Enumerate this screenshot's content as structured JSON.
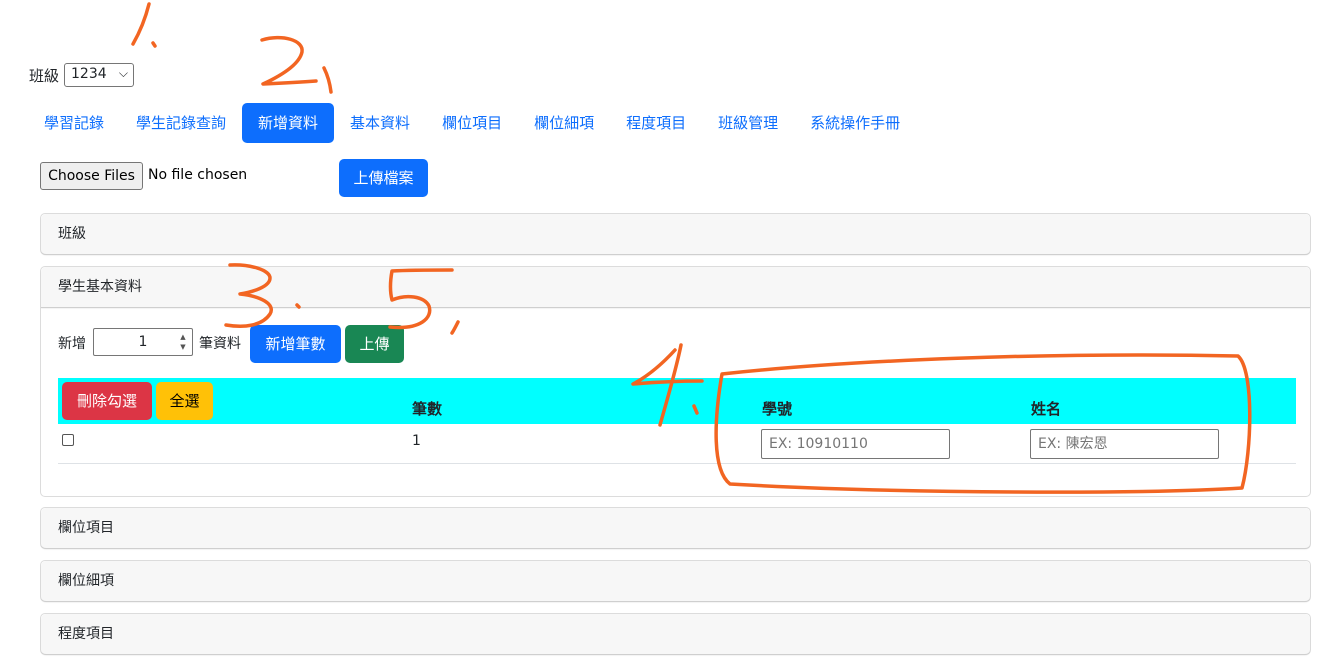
{
  "class_selector": {
    "label": "班級",
    "value": "1234"
  },
  "nav": {
    "items": [
      {
        "label": "學習記錄",
        "active": false
      },
      {
        "label": "學生記錄查詢",
        "active": false
      },
      {
        "label": "新增資料",
        "active": true
      },
      {
        "label": "基本資料",
        "active": false
      },
      {
        "label": "欄位項目",
        "active": false
      },
      {
        "label": "欄位細項",
        "active": false
      },
      {
        "label": "程度項目",
        "active": false
      },
      {
        "label": "班級管理",
        "active": false
      },
      {
        "label": "系統操作手冊",
        "active": false
      }
    ]
  },
  "upload": {
    "choose_label": "Choose Files",
    "status": "No file chosen",
    "submit_label": "上傳檔案"
  },
  "sections": {
    "class_title": "班級",
    "student_title": "學生基本資料",
    "field_items_title": "欄位項目",
    "field_details_title": "欄位細項",
    "level_items_title": "程度項目"
  },
  "student_form": {
    "add_prefix": "新增",
    "count_value": "1",
    "add_suffix": "筆資料",
    "add_rows_label": "新增筆數",
    "upload_label": "上傳",
    "delete_checked_label": "刪除勾選",
    "select_all_label": "全選",
    "columns": [
      "筆數",
      "學號",
      "姓名"
    ],
    "rows": [
      {
        "index": "1",
        "student_id_placeholder": "EX: 10910110",
        "name_placeholder": "EX: 陳宏恩"
      }
    ]
  },
  "annotations": [
    "1.",
    "2.",
    "3.",
    "5.",
    "4."
  ],
  "colors": {
    "primary": "#0d6efd",
    "success": "#198754",
    "danger": "#dc3545",
    "warning": "#ffc107",
    "table_header": "#00ffff",
    "annotation": "#f26522"
  }
}
